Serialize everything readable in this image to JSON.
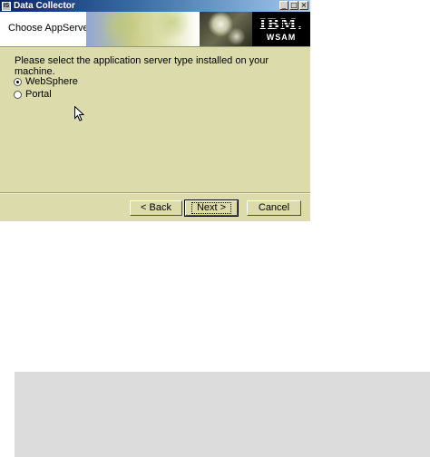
{
  "window": {
    "title": "Data Collector",
    "app_icon_label": "IS",
    "controls": {
      "minimize": "_",
      "maximize": "□",
      "close": "×"
    }
  },
  "header": {
    "title": "Choose AppServer",
    "logo": {
      "brand": "IBM.",
      "product": "WSAM"
    }
  },
  "content": {
    "prompt": "Please select the application server type installed on your machine.",
    "options": [
      {
        "label": "WebSphere",
        "selected": true
      },
      {
        "label": "Portal",
        "selected": false
      }
    ]
  },
  "buttons": {
    "back": "< Back",
    "next": "Next >",
    "cancel": "Cancel"
  },
  "colors": {
    "panel_bg": "#dcdbac",
    "titlebar_start": "#0a246a",
    "logo_bg": "#000000",
    "desktop_panel": "#dcdcdc"
  }
}
